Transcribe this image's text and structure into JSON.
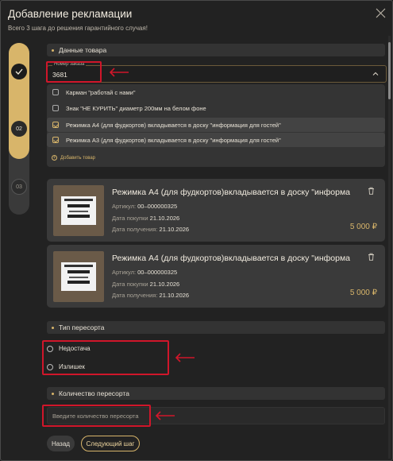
{
  "modal": {
    "title": "Добавление рекламации",
    "subtitle": "Всего 3 шага до решения гарантийного случая!"
  },
  "stepper": {
    "done_icon": "check-icon",
    "step2": "02",
    "step3": "03"
  },
  "product_section": {
    "title": "Данные товара"
  },
  "order_input": {
    "label": "Номер заказа",
    "value": "3681"
  },
  "options": [
    {
      "label": "Карман \"работай с нами\"",
      "checked": false
    },
    {
      "label": "Знак \"НЕ КУРИТЬ\" диаметр 200мм на белом фоне",
      "checked": false
    },
    {
      "label": "Режимка А4 (для фудкортов) вкладывается в доску \"информация для гостей\"",
      "checked": true
    },
    {
      "label": "Режимка А3 (для фудкортов) вкладывается в доску \"информация для гостей\"",
      "checked": true
    }
  ],
  "add_item": "Добавить товар",
  "cards": [
    {
      "name": "Режимка А4 (для фудкортов)вкладывается в доску \"информа...",
      "article_label": "Артикул:",
      "article": "00–000000325",
      "purchase_label": "Дата покупки",
      "purchase": "21.10.2026",
      "receipt_label": "Дата получения:",
      "receipt": "21.10.2026",
      "price": "5 000 ₽"
    },
    {
      "name": "Режимка А4 (для фудкортов)вкладывается в доску \"информа...",
      "article_label": "Артикул:",
      "article": "00–000000325",
      "purchase_label": "Дата покупки",
      "purchase": "21.10.2026",
      "receipt_label": "Дата получения:",
      "receipt": "21.10.2026",
      "price": "5 000 ₽"
    }
  ],
  "resort_type": {
    "title": "Тип пересорта",
    "options": [
      "Недостача",
      "Излишек"
    ]
  },
  "resort_qty": {
    "title": "Количество пересорта",
    "placeholder": "Введите количество пересорта"
  },
  "buttons": {
    "back": "Назад",
    "next": "Следующий шаг"
  },
  "colors": {
    "accent": "#d8b56a",
    "highlight": "#d0162a",
    "background": "#222222"
  }
}
